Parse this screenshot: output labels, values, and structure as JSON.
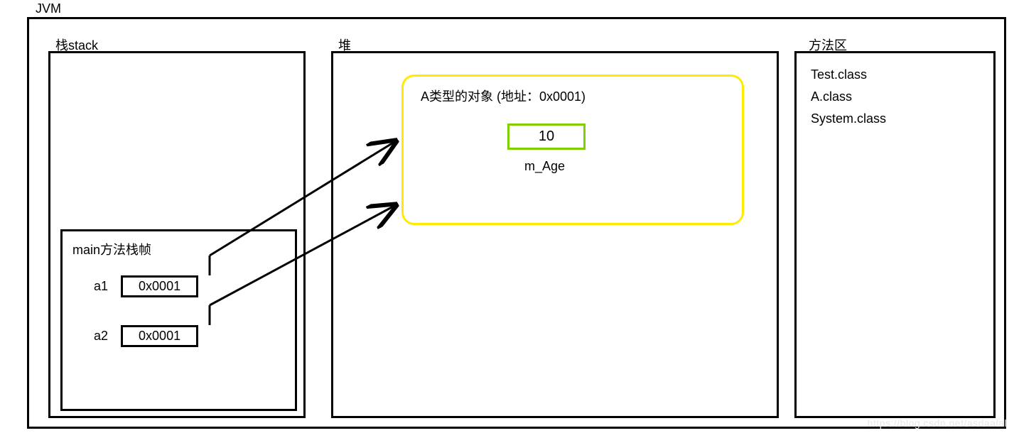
{
  "jvm": {
    "label": "JVM"
  },
  "stack": {
    "label": "栈stack",
    "frame": {
      "label": "main方法栈帧",
      "vars": {
        "a1": {
          "name": "a1",
          "value": "0x0001"
        },
        "a2": {
          "name": "a2",
          "value": "0x0001"
        }
      }
    }
  },
  "heap": {
    "label": "堆",
    "object": {
      "label": "A类型的对象 (地址：0x0001)",
      "field": {
        "name": "m_Age",
        "value": "10"
      }
    }
  },
  "methodArea": {
    "label": "方法区",
    "classes": [
      "Test.class",
      "A.class",
      "System.class"
    ]
  },
  "watermark": "https://blog.csdn.net/asdaalal"
}
